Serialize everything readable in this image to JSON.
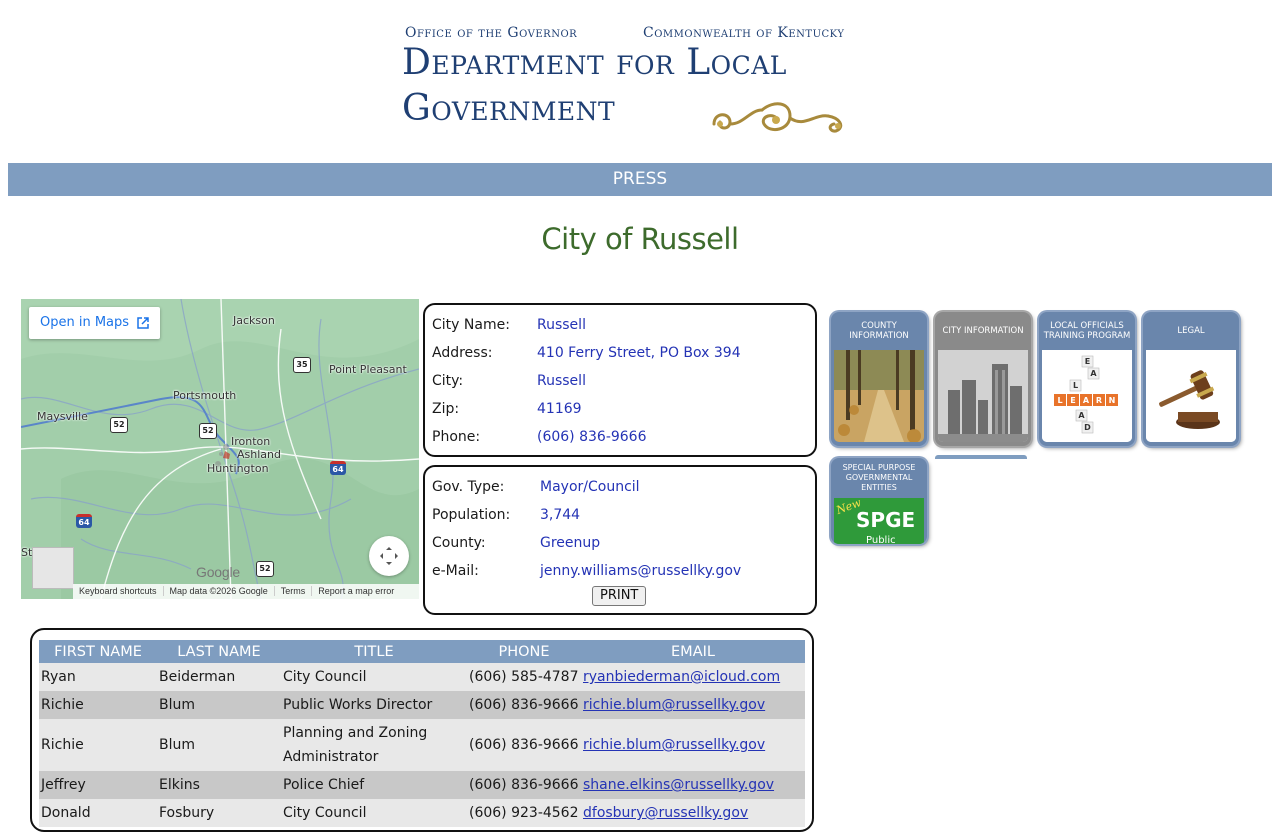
{
  "header": {
    "office_left": "Office of the Governor",
    "office_right": "Commonwealth of Kentucky",
    "title_line1": "Department for Local",
    "title_line2": "Government"
  },
  "nav": {
    "items": [
      {
        "label": "PRESS"
      }
    ]
  },
  "page_title": "City of Russell",
  "map": {
    "open_in_maps": "Open in Maps",
    "labels": {
      "jackson": "Jackson",
      "point_pleasant": "Point Pleasant",
      "portsmouth": "Portsmouth",
      "maysville": "Maysville",
      "ironton": "Ironton",
      "ashland": "Ashland",
      "huntington": "Huntington",
      "st": "St"
    },
    "shields": {
      "us35": "35",
      "us52a": "52",
      "us52b": "52",
      "us52c": "52",
      "i64a": "64",
      "i64b": "64"
    },
    "google": "Google",
    "footer": {
      "shortcuts": "Keyboard shortcuts",
      "data": "Map data ©2026 Google",
      "terms": "Terms",
      "report": "Report a map error"
    }
  },
  "city_info": {
    "city_name_label": "City Name:",
    "city_name": "Russell",
    "address_label": "Address:",
    "address": "410 Ferry Street, PO Box 394",
    "city_label": "City:",
    "city": "Russell",
    "zip_label": "Zip:",
    "zip": "41169",
    "phone_label": "Phone:",
    "phone": "(606) 836-9666"
  },
  "gov_info": {
    "gov_type_label": "Gov. Type:",
    "gov_type": "Mayor/Council",
    "population_label": "Population:",
    "population": "3,744",
    "county_label": "County:",
    "county": "Greenup",
    "email_label": "e-Mail:",
    "email": "jenny.williams@russellky.gov",
    "print_label": "PRINT"
  },
  "tiles": {
    "county": "COUNTY INFORMATION",
    "city": "CITY INFORMATION",
    "training": "LOCAL OFFICIALS TRAINING PROGRAM",
    "legal": "LEGAL",
    "spge": "SPECIAL PURPOSE GOVERNMENTAL ENTITIES",
    "spge_logo": "SPGE",
    "spge_new": "New",
    "spge_public": "Public"
  },
  "officials": {
    "headers": [
      "FIRST NAME",
      "LAST NAME",
      "TITLE",
      "PHONE",
      "EMAIL"
    ],
    "rows": [
      {
        "first": "Ryan",
        "last": "Beiderman",
        "title": "City Council",
        "phone": "(606) 585-4787",
        "email": "ryanbiederman@icloud.com"
      },
      {
        "first": "Richie",
        "last": "Blum",
        "title": "Public Works Director",
        "phone": "(606) 836-9666",
        "email": "richie.blum@russellky.gov"
      },
      {
        "first": "Richie",
        "last": "Blum",
        "title": "Planning and Zoning Administrator",
        "phone": "(606) 836-9666",
        "email": "richie.blum@russellky.gov"
      },
      {
        "first": "Jeffrey",
        "last": "Elkins",
        "title": "Police Chief",
        "phone": "(606) 836-9666",
        "email": "shane.elkins@russellky.gov"
      },
      {
        "first": "Donald",
        "last": "Fosbury",
        "title": "City Council",
        "phone": "(606) 923-4562",
        "email": "dfosbury@russellky.gov"
      }
    ]
  },
  "colors": {
    "nav": "#7f9dc0",
    "title_green": "#3d6b2c",
    "header_blue": "#1f3f73",
    "value_blue": "#2433b5"
  }
}
